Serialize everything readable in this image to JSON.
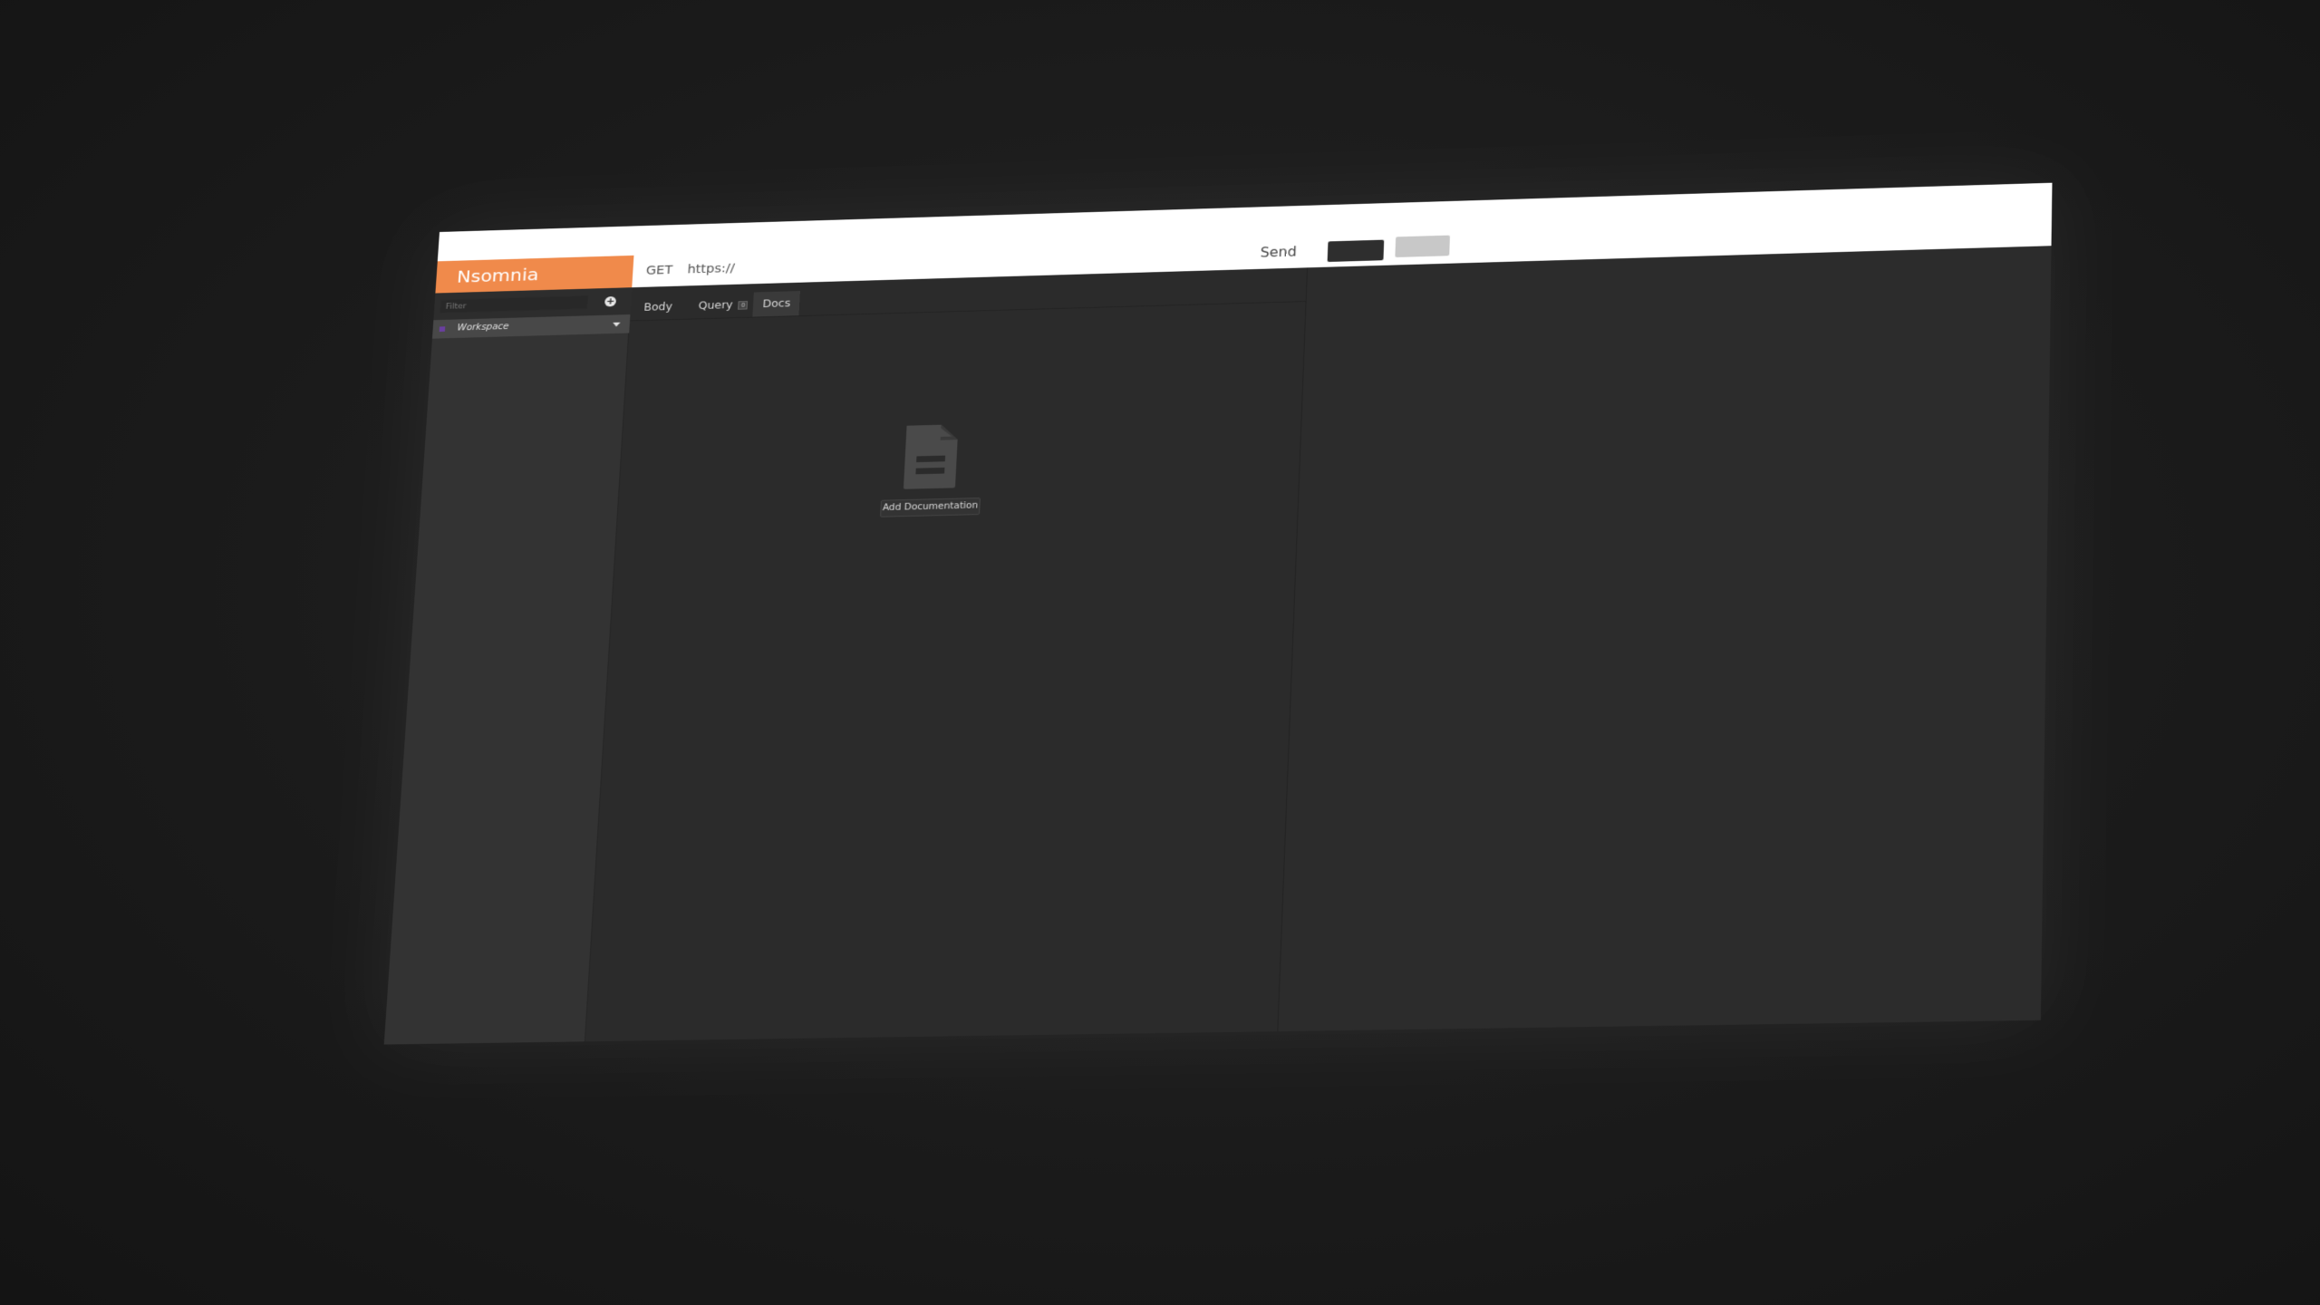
{
  "app": {
    "name": "Nsomnia"
  },
  "url_bar": {
    "method": "GET",
    "url": "https://",
    "send_label": "Send"
  },
  "sidebar": {
    "filter_placeholder": "Filter",
    "add_symbol": "+",
    "workspace_label": "Workspace"
  },
  "request": {
    "tabs": [
      {
        "label": "Body",
        "active": false
      },
      {
        "label": "Query",
        "active": false,
        "badge": "0"
      },
      {
        "label": "Docs",
        "active": true
      }
    ],
    "docs": {
      "icon": "document-icon",
      "button_label": "Add Documentation"
    }
  },
  "colors": {
    "brand_orange": "#f08a4b",
    "background": "#2b2b2b",
    "sidebar": "#333333",
    "workspace_bar": "#484848"
  }
}
